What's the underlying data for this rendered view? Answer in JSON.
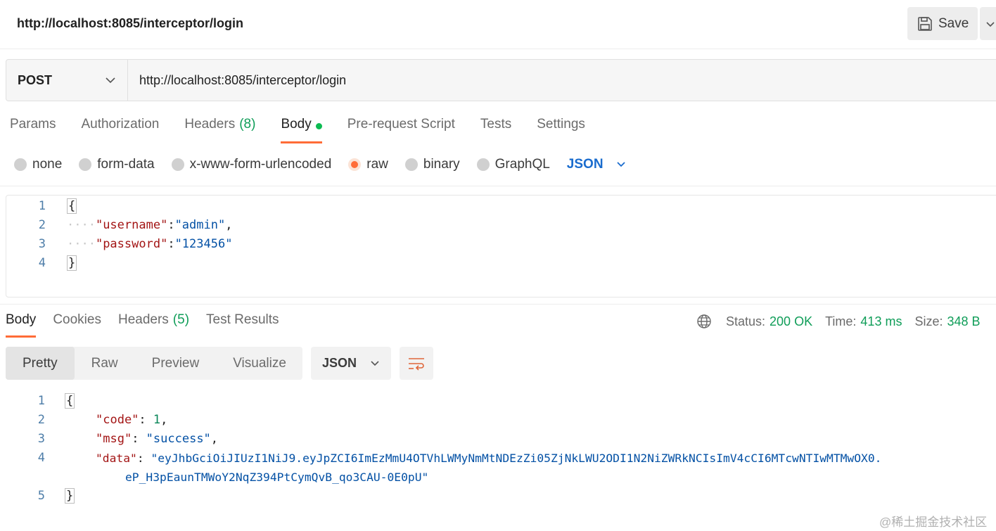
{
  "request": {
    "title": "http://localhost:8085/interceptor/login",
    "save_label": "Save",
    "method": "POST",
    "url": "http://localhost:8085/interceptor/login"
  },
  "request_tabs": [
    {
      "label": "Params",
      "count": ""
    },
    {
      "label": "Authorization",
      "count": ""
    },
    {
      "label": "Headers",
      "count": "(8)"
    },
    {
      "label": "Body",
      "count": ""
    },
    {
      "label": "Pre-request Script",
      "count": ""
    },
    {
      "label": "Tests",
      "count": ""
    },
    {
      "label": "Settings",
      "count": ""
    }
  ],
  "body_types": [
    "none",
    "form-data",
    "x-www-form-urlencoded",
    "raw",
    "binary",
    "GraphQL"
  ],
  "body_format": "JSON",
  "request_body": {
    "line_numbers": [
      "1",
      "2",
      "3",
      "4"
    ],
    "open_brace": "{",
    "close_brace": "}",
    "indent": "····",
    "username_key": "\"username\"",
    "username_value": "\"admin\"",
    "password_key": "\"password\"",
    "password_value": "\"123456\""
  },
  "response_tabs": [
    {
      "label": "Body",
      "count": ""
    },
    {
      "label": "Cookies",
      "count": ""
    },
    {
      "label": "Headers",
      "count": "(5)"
    },
    {
      "label": "Test Results",
      "count": ""
    }
  ],
  "response_status": {
    "status_label": "Status:",
    "status_value": "200 OK",
    "time_label": "Time:",
    "time_value": "413 ms",
    "size_label": "Size:",
    "size_value": "348 B"
  },
  "view_modes": [
    "Pretty",
    "Raw",
    "Preview",
    "Visualize"
  ],
  "response_format": "JSON",
  "response_body": {
    "line_numbers": [
      "1",
      "2",
      "3",
      "4",
      "5"
    ],
    "open_brace": "{",
    "close_brace": "}",
    "code_key": "\"code\"",
    "code_value": "1",
    "msg_key": "\"msg\"",
    "msg_value": "\"success\"",
    "data_key": "\"data\"",
    "data_value_1": "\"eyJhbGciOiJIUzI1NiJ9.eyJpZCI6ImEzMmU4OTVhLWMyNmMtNDEzZi05ZjNkLWU2ODI1N2NiZWRkNCIsImV4cCI6MTcwNTIwMTMwOX0.",
    "data_value_2": "eP_H3pEaunTMWoY2NqZ394PtCymQvB_qo3CAU-0E0pU\""
  },
  "watermark": "@稀土掘金技术社区",
  "colors": {
    "accent": "#ff6c37",
    "green": "#0f9d58",
    "link": "#1a6cce"
  }
}
